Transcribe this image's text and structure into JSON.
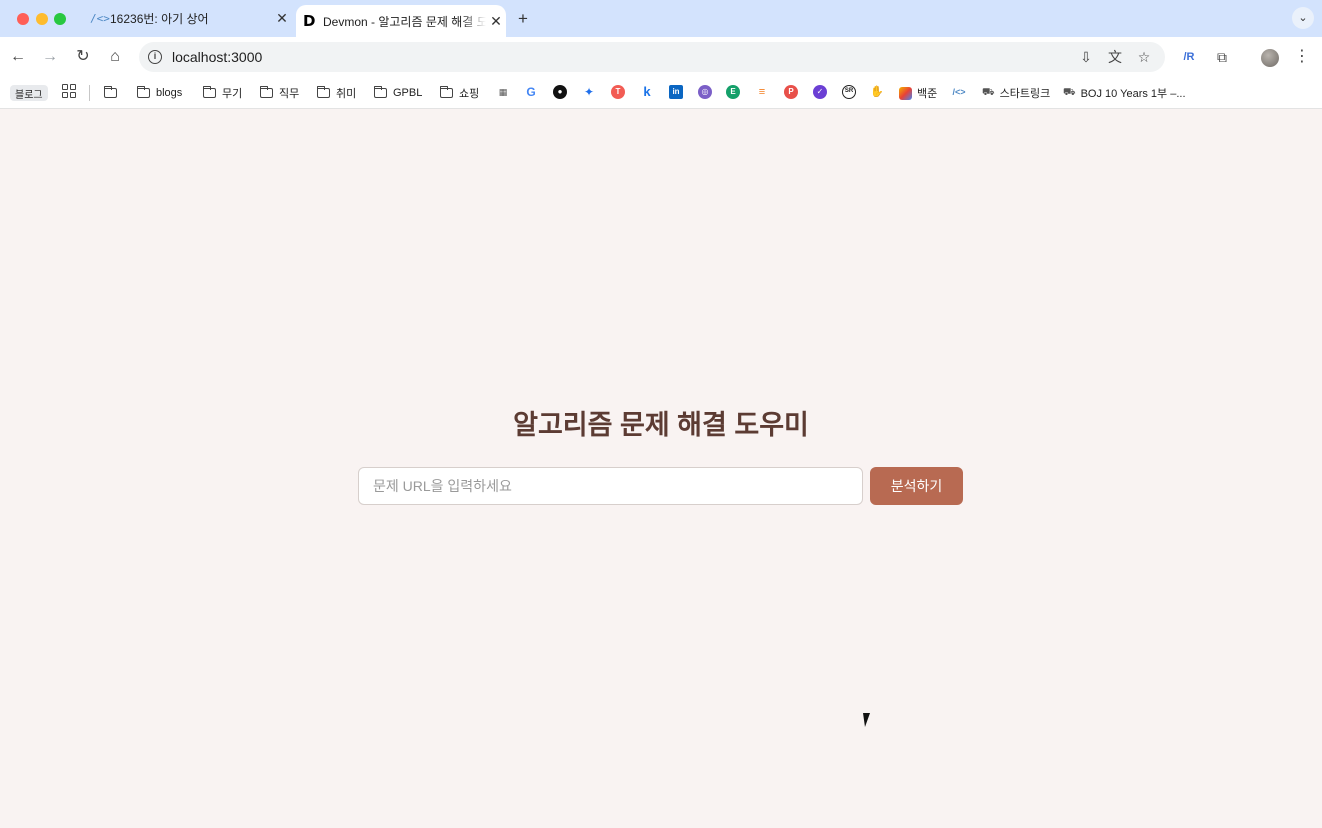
{
  "tabs": [
    {
      "title": "16236번: 아기 상어",
      "favicon": "code-brackets-icon"
    },
    {
      "title": "Devmon - 알고리즘 문제 해결 도우미",
      "favicon": "d-logo-icon",
      "active": true
    }
  ],
  "toolbar": {
    "url": "localhost:3000"
  },
  "bookmarks": {
    "chip": "블로그",
    "folders": [
      "blogs",
      "무기",
      "직무",
      "취미",
      "GPBL",
      "쇼핑"
    ],
    "named": [
      "백준",
      "스타트링크",
      "BOJ 10 Years 1부 –..."
    ]
  },
  "main": {
    "title": "알고리즘 문제 해결 도우미",
    "input_placeholder": "문제 URL을 입력하세요",
    "button_label": "분석하기"
  },
  "colors": {
    "page_bg": "#f9f3f2",
    "title": "#5c3b33",
    "button": "#b86a52"
  }
}
